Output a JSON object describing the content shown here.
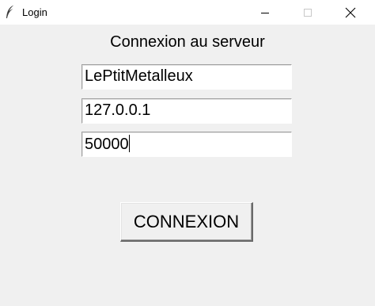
{
  "window": {
    "title": "Login",
    "icon": "feather-icon"
  },
  "titlebar_buttons": {
    "minimize": "minimize-icon",
    "maximize": "maximize-icon",
    "close": "close-icon"
  },
  "form": {
    "heading": "Connexion au serveur",
    "username_value": "LePtitMetalleux",
    "host_value": "127.0.0.1",
    "port_value": "50000",
    "connect_label": "CONNEXION"
  },
  "colors": {
    "background": "#f0f0f0",
    "field_background": "#ffffff",
    "titlebar": "#ffffff"
  }
}
